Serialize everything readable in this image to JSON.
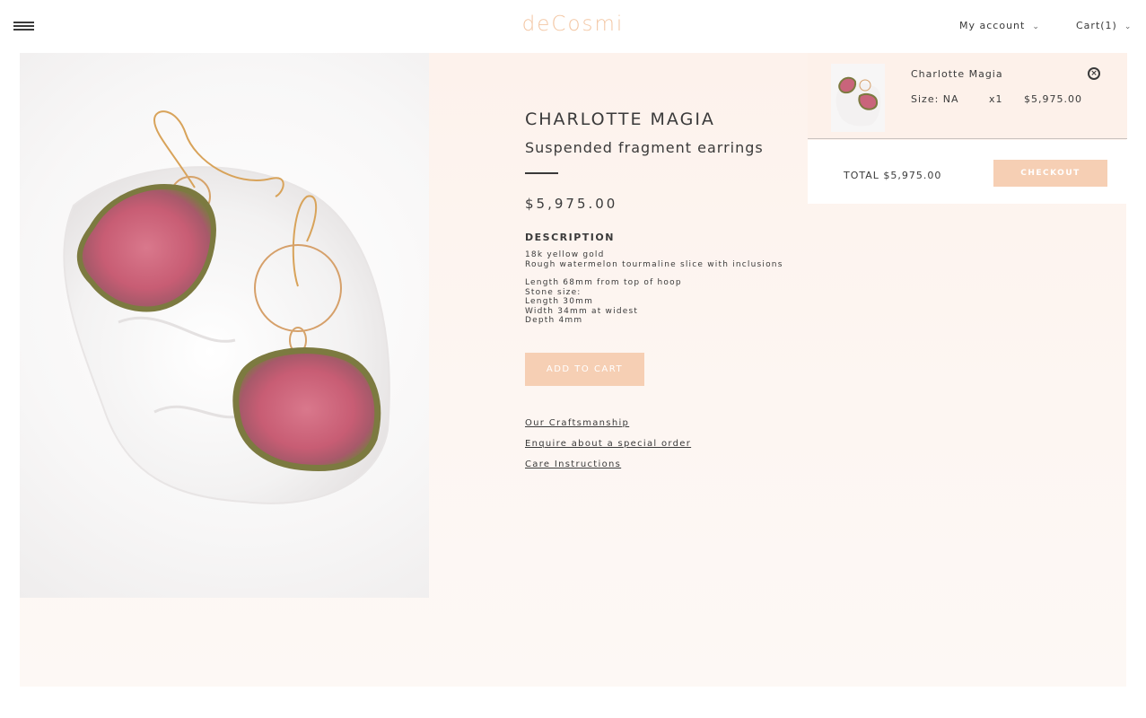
{
  "header": {
    "logo": "deCosmi",
    "account_label": "My account",
    "cart_label": "Cart(1)",
    "menu_icon": "hamburger-icon",
    "chevron_icon": "chevron-down-icon"
  },
  "product": {
    "brand": "CHARLOTTE MAGIA",
    "name": "Suspended fragment earrings",
    "price": "$5,975.00",
    "description_heading": "DESCRIPTION",
    "description_lines_1": [
      "18k yellow gold",
      "Rough watermelon tourmaline slice with inclusions"
    ],
    "description_lines_2": [
      "Length 68mm from top of hoop",
      "Stone size:",
      "Length 30mm",
      "Width 34mm at widest",
      "Depth 4mm"
    ],
    "add_to_cart_label": "ADD TO CART",
    "links": [
      "Our Craftsmanship",
      "Enquire about a special order",
      "Care Instructions"
    ]
  },
  "cart": {
    "item": {
      "name": "Charlotte Magia",
      "size": "Size: NA",
      "quantity": "x1",
      "price": "$5,975.00",
      "remove_icon": "remove-circle-icon"
    },
    "total": "TOTAL $5,975.00",
    "checkout_label": "CHECKOUT"
  },
  "colors": {
    "accent": "#f6cfb4",
    "logo": "#f3c6a3",
    "text": "#3a3a3a",
    "panel_bg": "#fdf3ee"
  }
}
